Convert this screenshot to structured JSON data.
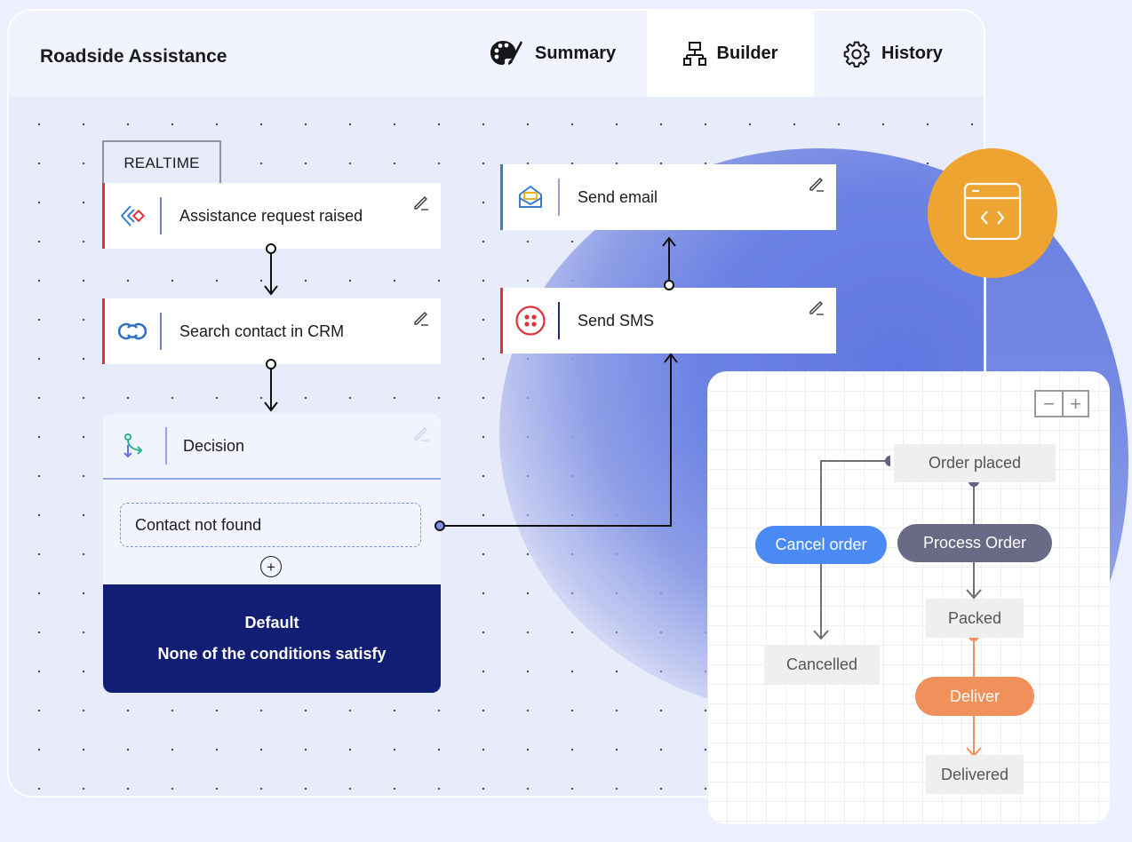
{
  "app": {
    "title": "Roadside Assistance"
  },
  "tabs": [
    {
      "label": "Summary",
      "icon": "palette-icon",
      "active": false
    },
    {
      "label": "Builder",
      "icon": "sitemap-icon",
      "active": true
    },
    {
      "label": "History",
      "icon": "gear-icon",
      "active": false
    }
  ],
  "flow": {
    "trigger_tag": "REALTIME",
    "nodes": [
      {
        "label": "Assistance request raised",
        "icon": "webhook-trigger-icon"
      },
      {
        "label": "Search contact in CRM",
        "icon": "crm-link-icon"
      },
      {
        "label": "Send email",
        "icon": "mail-icon"
      },
      {
        "label": "Send SMS",
        "icon": "sms-icon"
      }
    ],
    "decision": {
      "label": "Decision",
      "icon": "branch-icon",
      "conditions": [
        "Contact not found"
      ],
      "default_title": "Default",
      "default_text": "None of the conditions satisfy"
    }
  },
  "badge": {
    "icon": "code-window-icon"
  },
  "state_diagram": {
    "zoom_out": "−",
    "zoom_in": "+",
    "states": {
      "order_placed": "Order placed",
      "packed": "Packed",
      "cancelled": "Cancelled",
      "delivered": "Delivered"
    },
    "actions": {
      "cancel_order": "Cancel order",
      "process_order": "Process Order",
      "deliver": "Deliver"
    },
    "colors": {
      "cancel": "#4b8af5",
      "process": "#696a85",
      "deliver": "#f0905a",
      "navy": "#121e74",
      "orange_badge": "#eea431"
    }
  }
}
